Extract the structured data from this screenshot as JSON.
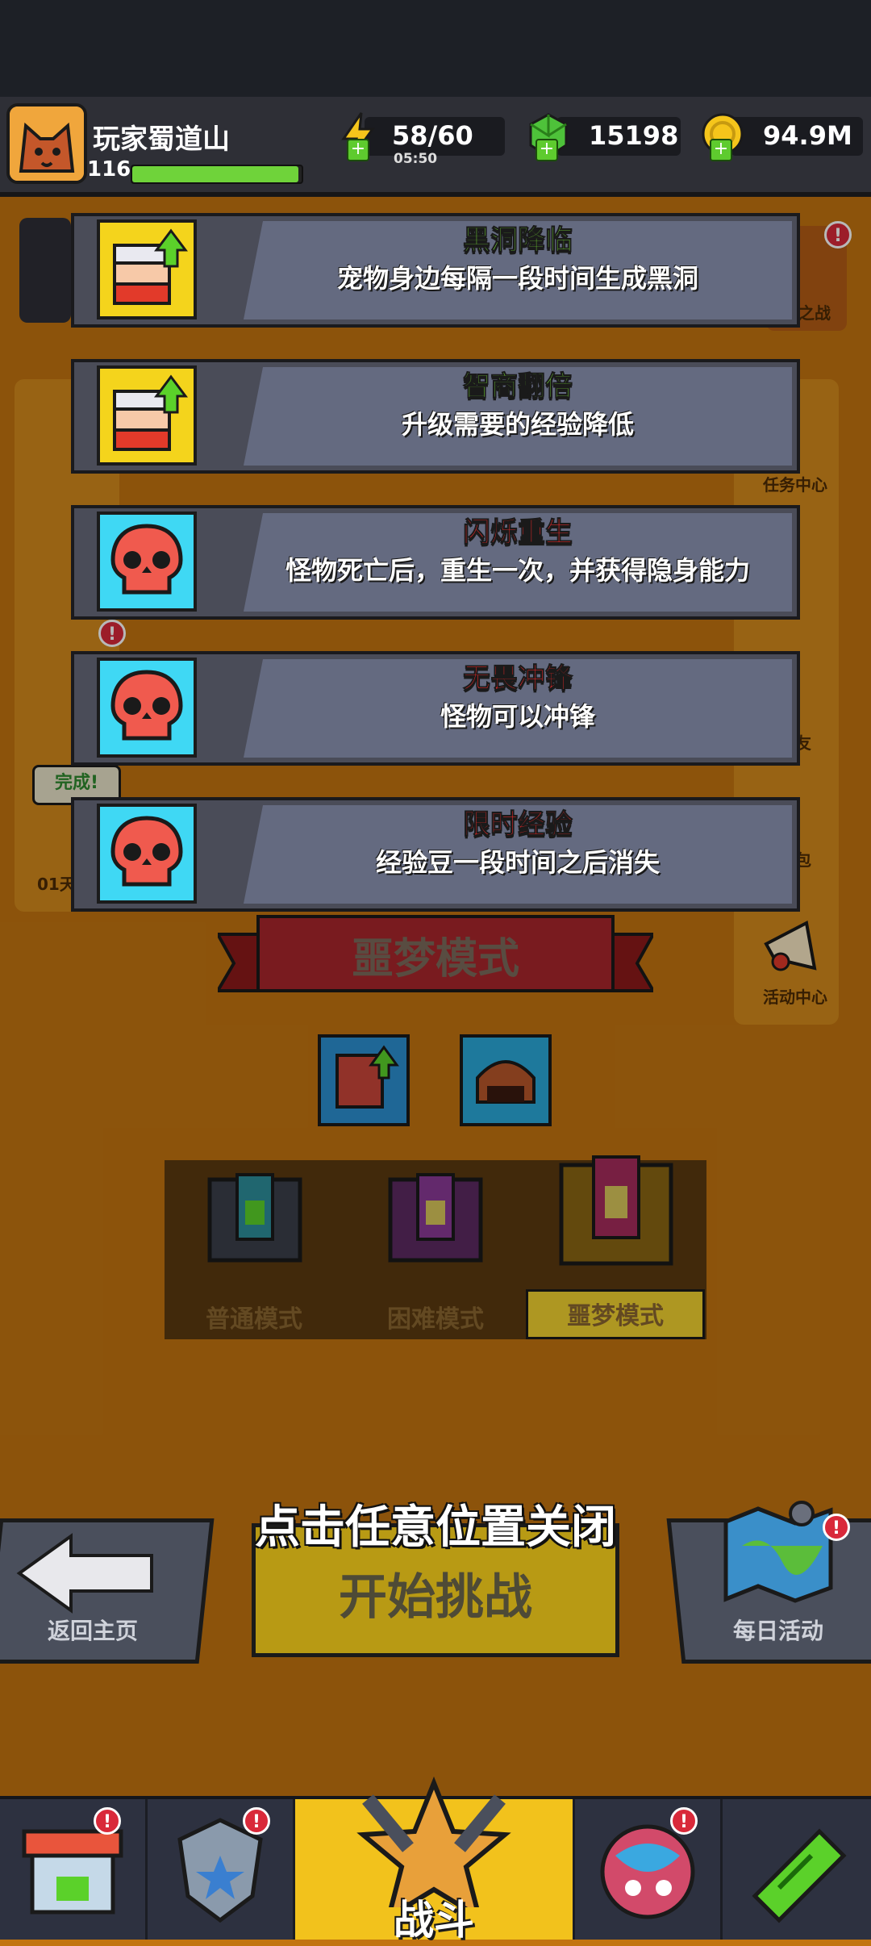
{
  "header": {
    "player_name": "玩家蜀道山",
    "level": "116",
    "xp_fraction": 0.98,
    "energy": {
      "value": "58/60",
      "timer": "05:50"
    },
    "gems": {
      "value": "15198"
    },
    "gold": {
      "value": "94.9M"
    }
  },
  "side_menu": {
    "right": [
      "之战",
      "任务中心",
      "好友",
      "背包",
      "活动中心"
    ],
    "left": [
      "完成!",
      "01天"
    ]
  },
  "buffs": [
    {
      "title": "黑洞降临",
      "desc": "宠物身边每隔一段时间生成黑洞",
      "icon": "pet-upgrade-icon",
      "title_color": "#7ee83a"
    },
    {
      "title": "智商翻倍",
      "desc": "升级需要的经验降低",
      "icon": "pet-upgrade-icon",
      "title_color": "#7ee83a"
    },
    {
      "title": "闪烁重生",
      "desc": "怪物死亡后，重生一次，并获得隐身能力",
      "icon": "skull-icon",
      "title_color": "#ff2a2a"
    },
    {
      "title": "无畏冲锋",
      "desc": "怪物可以冲锋",
      "icon": "skull-icon",
      "title_color": "#ff2a2a"
    },
    {
      "title": "限时经验",
      "desc": "经验豆一段时间之后消失",
      "icon": "skull-icon",
      "title_color": "#ff2a2a"
    }
  ],
  "mode_banner": "噩梦模式",
  "mode_tabs": [
    "普通模式",
    "困难模式",
    "噩梦模式"
  ],
  "selected_mode_index": 2,
  "close_hint": "点击任意位置关闭",
  "start_button": "开始挑战",
  "back_button": "返回主页",
  "daily_button": "每日活动",
  "bottom_nav": {
    "battle": "战斗"
  },
  "colors": {
    "accent_green": "#7ee83a",
    "danger_red": "#ff2a2a",
    "card_bg": "#646a80",
    "selected_tab": "#f2d130"
  }
}
